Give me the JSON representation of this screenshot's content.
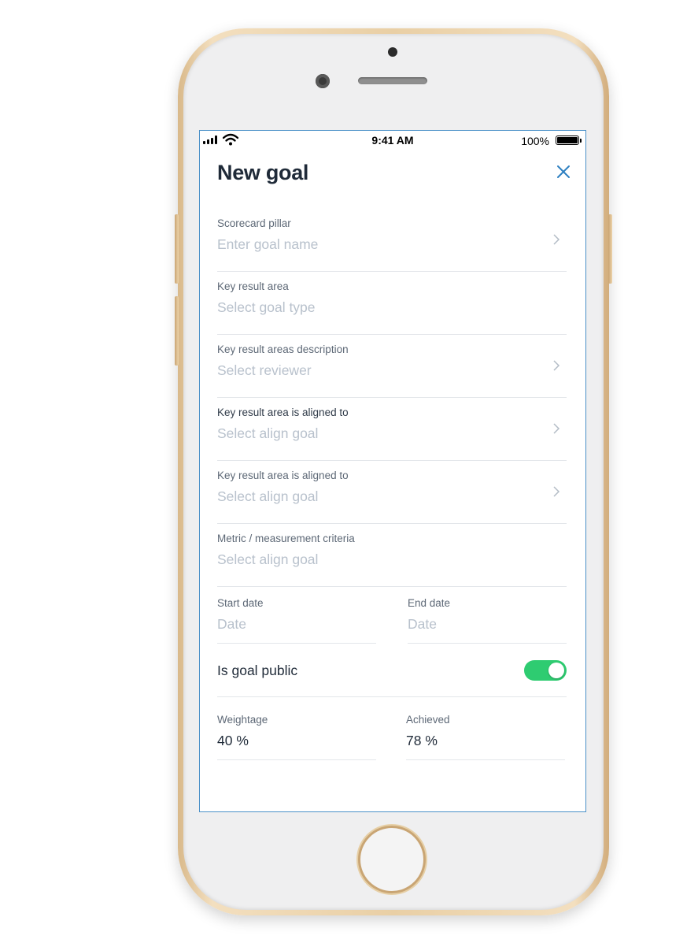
{
  "status_bar": {
    "time": "9:41 AM",
    "battery": "100%"
  },
  "header": {
    "title": "New goal"
  },
  "fields": [
    {
      "label": "Scorecard pillar",
      "placeholder": "Enter goal name"
    },
    {
      "label": "Key result area",
      "placeholder": "Select goal type"
    },
    {
      "label": "Key result areas description",
      "placeholder": "Select reviewer"
    },
    {
      "label": "Key result area is aligned to",
      "placeholder": "Select align goal"
    },
    {
      "label": "Key result area is aligned to",
      "placeholder": "Select align goal"
    },
    {
      "label": "Metric / measurement criteria",
      "placeholder": "Select align goal"
    }
  ],
  "dates": {
    "start": {
      "label": "Start date",
      "placeholder": "Date"
    },
    "end": {
      "label": "End date",
      "placeholder": "Date"
    }
  },
  "public_toggle": {
    "label": "Is goal public",
    "on": true
  },
  "stats": {
    "weightage": {
      "label": "Weightage",
      "value": "40 %"
    },
    "achieved": {
      "label": "Achieved",
      "value": "78 %"
    }
  },
  "colors": {
    "accent": "#2d7fc1",
    "toggle_on": "#2ecc71",
    "phone_gold": "#e9cfa5"
  }
}
